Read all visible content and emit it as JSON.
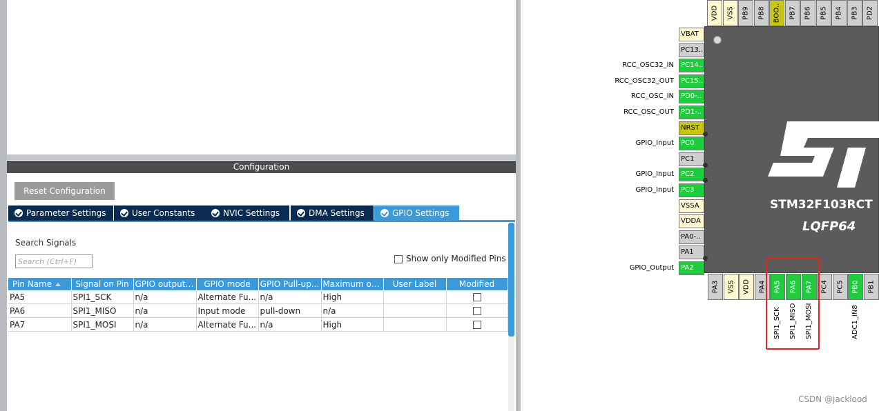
{
  "config": {
    "title": "Configuration",
    "reset_label": "Reset Configuration",
    "tabs": [
      {
        "label": "Parameter Settings"
      },
      {
        "label": "User Constants"
      },
      {
        "label": "NVIC Settings"
      },
      {
        "label": "DMA Settings"
      },
      {
        "label": "GPIO Settings"
      }
    ],
    "active_tab": "GPIO Settings",
    "search_label": "Search Signals",
    "search_placeholder": "Search (Ctrl+F)",
    "show_modified_label": "Show only Modified Pins",
    "columns": [
      "Pin Name",
      "Signal on Pin",
      "GPIO output ...",
      "GPIO mode",
      "GPIO Pull-up...",
      "Maximum ou...",
      "User Label",
      "Modified"
    ],
    "rows": [
      {
        "pin": "PA5",
        "signal": "SPI1_SCK",
        "output": "n/a",
        "mode": "Alternate Fu...",
        "pull": "n/a",
        "max": "High",
        "label": ""
      },
      {
        "pin": "PA6",
        "signal": "SPI1_MISO",
        "output": "n/a",
        "mode": "Input mode",
        "pull": "pull-down",
        "max": "n/a",
        "label": ""
      },
      {
        "pin": "PA7",
        "signal": "SPI1_MOSI",
        "output": "n/a",
        "mode": "Alternate Fu...",
        "pull": "n/a",
        "max": "High",
        "label": ""
      }
    ]
  },
  "chip": {
    "name": "STM32F103RCT",
    "package": "LQFP64",
    "top_pins": [
      "VDD",
      "VSS",
      "PB9",
      "PB8",
      "BOO..",
      "PB7",
      "PB6",
      "PB5",
      "PB4",
      "PB3",
      "PD2"
    ],
    "left_pins": [
      {
        "pin": "VBAT",
        "signal": ""
      },
      {
        "pin": "PC13..",
        "signal": ""
      },
      {
        "pin": "PC14..",
        "signal": "RCC_OSC32_IN"
      },
      {
        "pin": "PC15..",
        "signal": "RCC_OSC32_OUT"
      },
      {
        "pin": "PD0-..",
        "signal": "RCC_OSC_IN"
      },
      {
        "pin": "PD1-..",
        "signal": "RCC_OSC_OUT"
      },
      {
        "pin": "NRST",
        "signal": ""
      },
      {
        "pin": "PC0",
        "signal": "GPIO_Input"
      },
      {
        "pin": "PC1",
        "signal": ""
      },
      {
        "pin": "PC2",
        "signal": "GPIO_Input"
      },
      {
        "pin": "PC3",
        "signal": "GPIO_Input"
      },
      {
        "pin": "VSSA",
        "signal": ""
      },
      {
        "pin": "VDDA",
        "signal": ""
      },
      {
        "pin": "PA0-..",
        "signal": ""
      },
      {
        "pin": "PA1",
        "signal": ""
      },
      {
        "pin": "PA2",
        "signal": "GPIO_Output"
      }
    ],
    "bottom_pins": [
      {
        "pin": "PA3",
        "signal": ""
      },
      {
        "pin": "VSS",
        "signal": ""
      },
      {
        "pin": "VDD",
        "signal": ""
      },
      {
        "pin": "PA4",
        "signal": ""
      },
      {
        "pin": "PA5",
        "signal": "SPI1_SCK"
      },
      {
        "pin": "PA6",
        "signal": "SPI1_MISO"
      },
      {
        "pin": "PA7",
        "signal": "SPI1_MOSI"
      },
      {
        "pin": "PC4",
        "signal": ""
      },
      {
        "pin": "PC5",
        "signal": ""
      },
      {
        "pin": "PB0",
        "signal": "ADC1_IN8"
      },
      {
        "pin": "PB1",
        "signal": ""
      }
    ]
  },
  "watermark": "CSDN @jacklood",
  "colors": {
    "pin_assigned": "#1fcc3d",
    "pin_power": "#fff7cf",
    "pin_unused": "#cfcfcf",
    "pin_boot": "#c9c716",
    "tab_active": "#3c9ad8",
    "tab_inactive": "#0b2a4f",
    "highlight": "#e8231b"
  }
}
